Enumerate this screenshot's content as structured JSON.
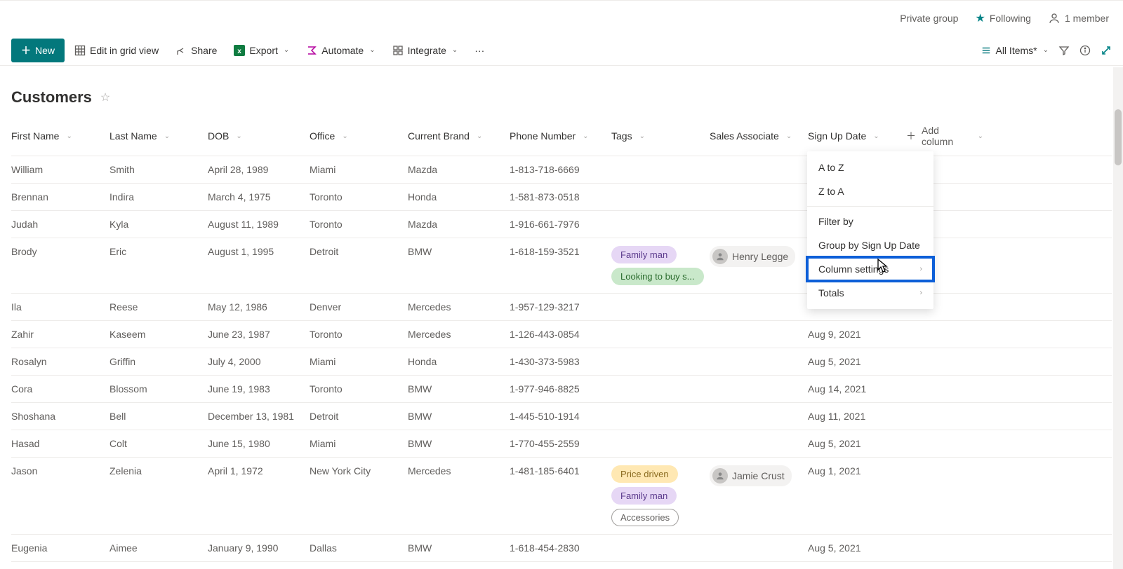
{
  "header": {
    "private_group": "Private group",
    "following": "Following",
    "members": "1 member"
  },
  "cmdbar": {
    "new": "New",
    "edit_grid": "Edit in grid view",
    "share": "Share",
    "export": "Export",
    "automate": "Automate",
    "integrate": "Integrate",
    "view_name": "All Items*"
  },
  "list_title": "Customers",
  "columns": {
    "first_name": "First Name",
    "last_name": "Last Name",
    "dob": "DOB",
    "office": "Office",
    "current_brand": "Current Brand",
    "phone": "Phone Number",
    "tags": "Tags",
    "sales_assoc": "Sales Associate",
    "signup": "Sign Up Date",
    "add": "Add column"
  },
  "rows": [
    {
      "first": "William",
      "last": "Smith",
      "dob": "April 28, 1989",
      "office": "Miami",
      "brand": "Mazda",
      "phone": "1-813-718-6669",
      "tags": [],
      "assoc": "",
      "signup": ""
    },
    {
      "first": "Brennan",
      "last": "Indira",
      "dob": "March 4, 1975",
      "office": "Toronto",
      "brand": "Honda",
      "phone": "1-581-873-0518",
      "tags": [],
      "assoc": "",
      "signup": ""
    },
    {
      "first": "Judah",
      "last": "Kyla",
      "dob": "August 11, 1989",
      "office": "Toronto",
      "brand": "Mazda",
      "phone": "1-916-661-7976",
      "tags": [],
      "assoc": "",
      "signup": ""
    },
    {
      "first": "Brody",
      "last": "Eric",
      "dob": "August 1, 1995",
      "office": "Detroit",
      "brand": "BMW",
      "phone": "1-618-159-3521",
      "tags": [
        {
          "t": "Family man",
          "c": "purple"
        },
        {
          "t": "Looking to buy s...",
          "c": "green"
        }
      ],
      "assoc": "Henry Legge",
      "signup": ""
    },
    {
      "first": "Ila",
      "last": "Reese",
      "dob": "May 12, 1986",
      "office": "Denver",
      "brand": "Mercedes",
      "phone": "1-957-129-3217",
      "tags": [],
      "assoc": "",
      "signup": ""
    },
    {
      "first": "Zahir",
      "last": "Kaseem",
      "dob": "June 23, 1987",
      "office": "Toronto",
      "brand": "Mercedes",
      "phone": "1-126-443-0854",
      "tags": [],
      "assoc": "",
      "signup": "Aug 9, 2021"
    },
    {
      "first": "Rosalyn",
      "last": "Griffin",
      "dob": "July 4, 2000",
      "office": "Miami",
      "brand": "Honda",
      "phone": "1-430-373-5983",
      "tags": [],
      "assoc": "",
      "signup": "Aug 5, 2021"
    },
    {
      "first": "Cora",
      "last": "Blossom",
      "dob": "June 19, 1983",
      "office": "Toronto",
      "brand": "BMW",
      "phone": "1-977-946-8825",
      "tags": [],
      "assoc": "",
      "signup": "Aug 14, 2021"
    },
    {
      "first": "Shoshana",
      "last": "Bell",
      "dob": "December 13, 1981",
      "office": "Detroit",
      "brand": "BMW",
      "phone": "1-445-510-1914",
      "tags": [],
      "assoc": "",
      "signup": "Aug 11, 2021"
    },
    {
      "first": "Hasad",
      "last": "Colt",
      "dob": "June 15, 1980",
      "office": "Miami",
      "brand": "BMW",
      "phone": "1-770-455-2559",
      "tags": [],
      "assoc": "",
      "signup": "Aug 5, 2021"
    },
    {
      "first": "Jason",
      "last": "Zelenia",
      "dob": "April 1, 1972",
      "office": "New York City",
      "brand": "Mercedes",
      "phone": "1-481-185-6401",
      "tags": [
        {
          "t": "Price driven",
          "c": "yellow"
        },
        {
          "t": "Family man",
          "c": "purple"
        },
        {
          "t": "Accessories",
          "c": "white"
        }
      ],
      "assoc": "Jamie Crust",
      "signup": "Aug 1, 2021"
    },
    {
      "first": "Eugenia",
      "last": "Aimee",
      "dob": "January 9, 1990",
      "office": "Dallas",
      "brand": "BMW",
      "phone": "1-618-454-2830",
      "tags": [],
      "assoc": "",
      "signup": "Aug 5, 2021"
    }
  ],
  "menu": {
    "a_to_z": "A to Z",
    "z_to_a": "Z to A",
    "filter_by": "Filter by",
    "group_by": "Group by Sign Up Date",
    "col_settings": "Column settings",
    "totals": "Totals"
  }
}
